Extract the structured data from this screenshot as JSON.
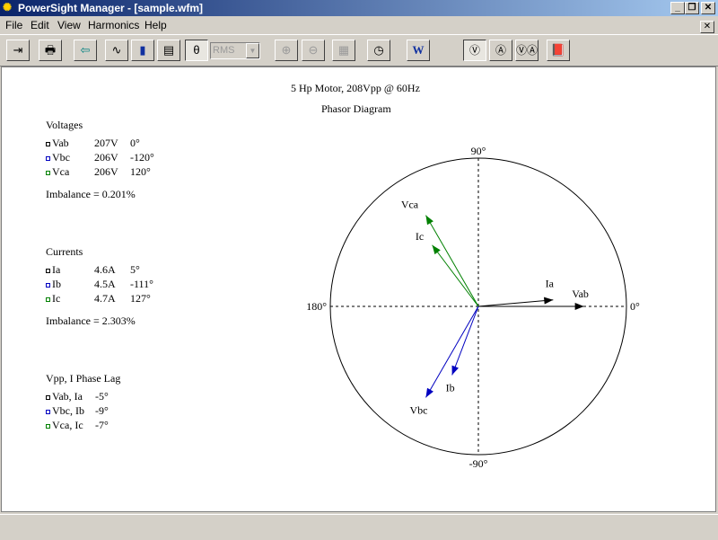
{
  "window": {
    "title": "PowerSight Manager - [sample.wfm]",
    "min_label": "_",
    "max_label": "❐",
    "close_label": "✕",
    "mdi_close_label": "✕"
  },
  "menu": {
    "items": [
      {
        "label": "File"
      },
      {
        "label": "Edit"
      },
      {
        "label": "View"
      },
      {
        "label": "Harmonics"
      },
      {
        "label": "Help"
      }
    ]
  },
  "toolbar": {
    "rms_value": "RMS",
    "buttons": [
      {
        "name": "exit-icon",
        "glyph": "⇥"
      },
      {
        "name": "print-icon",
        "glyph": "🖶"
      },
      {
        "name": "back-arrow-icon",
        "glyph": "⇦"
      },
      {
        "name": "waveform-icon",
        "glyph": "∿"
      },
      {
        "name": "harmonics-bars-icon",
        "glyph": "▮"
      },
      {
        "name": "report-icon",
        "glyph": "▤"
      },
      {
        "name": "phasor-icon",
        "glyph": "θ"
      },
      {
        "name": "zoom-in-icon",
        "glyph": "⊕"
      },
      {
        "name": "zoom-out-icon",
        "glyph": "⊖"
      },
      {
        "name": "properties-icon",
        "glyph": "▦"
      },
      {
        "name": "clock-icon",
        "glyph": "◷"
      },
      {
        "name": "word-export-icon",
        "glyph": "W"
      },
      {
        "name": "voltage-phasor-icon",
        "glyph": "Ⓥ"
      },
      {
        "name": "current-phasor-icon",
        "glyph": "Ⓐ"
      },
      {
        "name": "va-phasor-icon",
        "glyph": "ⓋⒶ"
      },
      {
        "name": "help-book-icon",
        "glyph": "📕"
      }
    ]
  },
  "report": {
    "header": "5 Hp Motor, 208Vpp @ 60Hz",
    "diagram_title": "Phasor Diagram",
    "voltages": {
      "heading": "Voltages",
      "rows": [
        {
          "name": "Vab",
          "mag": "207V",
          "angle": "0°",
          "color": "#000000"
        },
        {
          "name": "Vbc",
          "mag": "206V",
          "angle": "-120°",
          "color": "#0000c0"
        },
        {
          "name": "Vca",
          "mag": "206V",
          "angle": "120°",
          "color": "#008000"
        }
      ],
      "imbalance": "Imbalance = 0.201%"
    },
    "currents": {
      "heading": "Currents",
      "rows": [
        {
          "name": "Ia",
          "mag": "4.6A",
          "angle": "5°",
          "color": "#000000"
        },
        {
          "name": "Ib",
          "mag": "4.5A",
          "angle": "-111°",
          "color": "#0000c0"
        },
        {
          "name": "Ic",
          "mag": "4.7A",
          "angle": "127°",
          "color": "#008000"
        }
      ],
      "imbalance": "Imbalance = 2.303%"
    },
    "lag": {
      "heading": "Vpp, I Phase Lag",
      "rows": [
        {
          "name": "Vab, Ia",
          "value": "-5°",
          "color": "#000000"
        },
        {
          "name": "Vbc, Ib",
          "value": "-9°",
          "color": "#0000c0"
        },
        {
          "name": "Vca, Ic",
          "value": "-7°",
          "color": "#008000"
        }
      ]
    }
  },
  "phasor": {
    "axis_labels": {
      "top": "90°",
      "bottom": "-90°",
      "left": "180°",
      "right": "0°"
    },
    "max_magnitude": 220,
    "vectors": [
      {
        "label": "Vab",
        "magnitude": 207,
        "angle": 0,
        "color": "#000000"
      },
      {
        "label": "Vbc",
        "magnitude": 206,
        "angle": -120,
        "color": "#0000c0"
      },
      {
        "label": "Vca",
        "magnitude": 206,
        "angle": 120,
        "color": "#008000"
      },
      {
        "label": "Ia",
        "magnitude": 4.6,
        "angle": 5,
        "scale_ref": 5.5,
        "color": "#000000"
      },
      {
        "label": "Ib",
        "magnitude": 4.5,
        "angle": -111,
        "scale_ref": 5.5,
        "color": "#0000c0"
      },
      {
        "label": "Ic",
        "magnitude": 4.7,
        "angle": 127,
        "scale_ref": 5.5,
        "color": "#008000"
      }
    ]
  }
}
